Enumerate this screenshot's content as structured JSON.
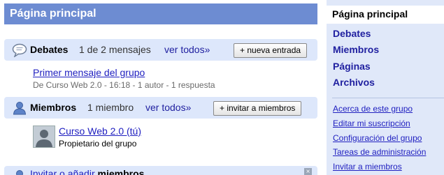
{
  "main": {
    "header_title": "Página principal",
    "debates": {
      "title": "Debates",
      "count": "1 de 2 mensajes",
      "more_link": "ver todos»",
      "button": "+ nueva entrada",
      "post": {
        "title": "Primer mensaje del grupo",
        "meta": "De Curso Web 2.0 - 16:18 - 1 autor - 1 respuesta"
      }
    },
    "miembros": {
      "title": "Miembros",
      "count": "1 miembro",
      "more_link": "ver todos»",
      "button": "+ invitar a miembros",
      "member": {
        "name": "Curso Web 2.0 (tú)",
        "role": "Propietario del grupo"
      }
    },
    "invite_bar": {
      "prefix": "Invitar o añadir ",
      "bold": "miembros",
      "close": "×"
    }
  },
  "sidebar": {
    "current": "Página principal",
    "nav": [
      "Debates",
      "Miembros",
      "Páginas",
      "Archivos"
    ],
    "links": [
      "Acerca de este grupo",
      "Editar mi suscripción",
      "Configuración del grupo",
      "Tareas de administración",
      "Invitar a miembros"
    ]
  },
  "colors": {
    "header_bg": "#6d8cd2",
    "section_bg": "#dde7fb",
    "sidebar_bg": "#e0e8f9",
    "link": "#2020c0"
  }
}
